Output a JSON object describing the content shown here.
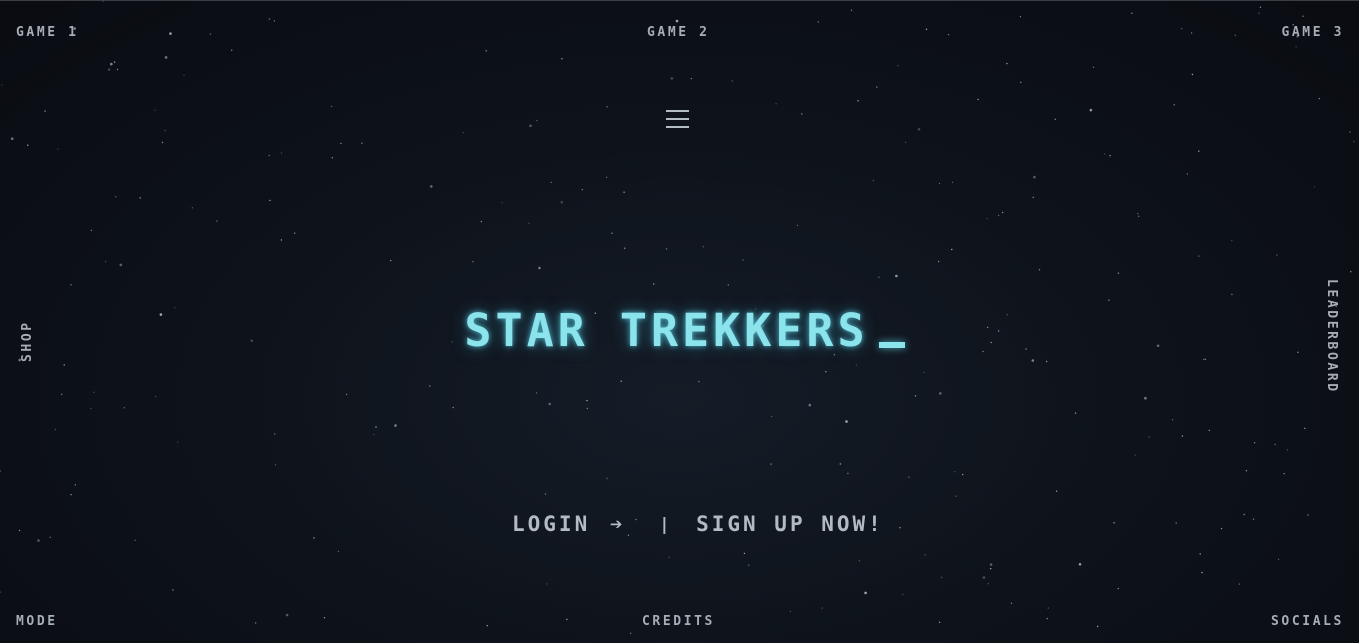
{
  "nav": {
    "game1": "GAME 1",
    "game2": "GAME 2",
    "game3": "GAME 3",
    "shop": "SHOP",
    "leaderboard": "LEADERBOARD",
    "mode": "MODE",
    "credits": "CREDITS",
    "socials": "SOCIALS"
  },
  "hero": {
    "title": "STAR TREKKERS"
  },
  "auth": {
    "login": "LOGIN",
    "arrow": "➔",
    "separator": "|",
    "signup": "SIGN UP NOW!"
  },
  "colors": {
    "background": "#0c0f16",
    "title": "#8be3ec",
    "nav_text": "#a6adb5",
    "stars": "#c8ced6"
  },
  "icons": {
    "menu": "hamburger-menu-icon",
    "login_arrow": "right-arrow-icon"
  }
}
